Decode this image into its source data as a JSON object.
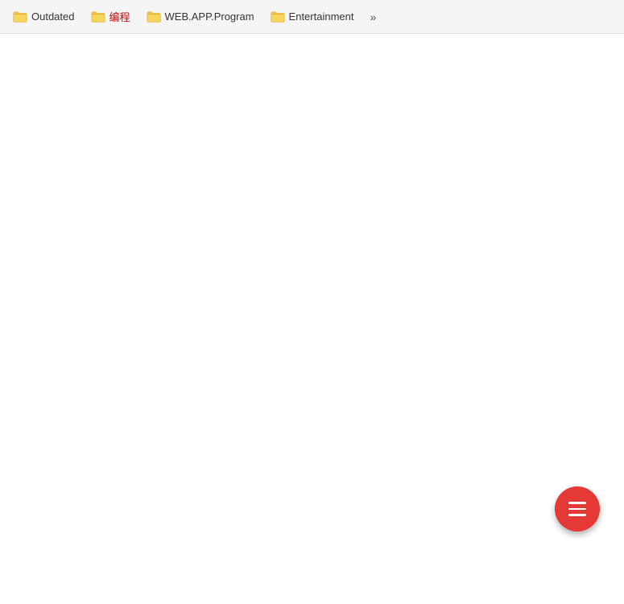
{
  "bookmarks_bar": {
    "items": [
      {
        "id": "outdated",
        "label": "Outdated",
        "label_class": ""
      },
      {
        "id": "biancheng",
        "label": "编程",
        "label_class": "chinese"
      },
      {
        "id": "webappprogram",
        "label": "WEB.APP.Program",
        "label_class": ""
      },
      {
        "id": "entertainment",
        "label": "Entertainment",
        "label_class": ""
      }
    ],
    "more_label": "»"
  },
  "fab": {
    "aria_label": "Menu"
  }
}
